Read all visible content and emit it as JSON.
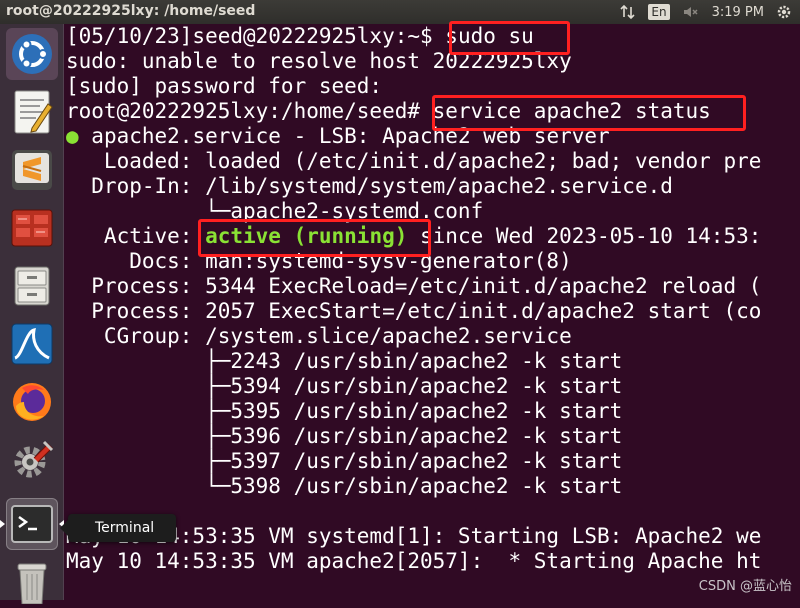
{
  "topbar": {
    "window_title": "root@20222925lxy: /home/seed",
    "lang": "En",
    "time": "3:19 PM"
  },
  "launcher": {
    "items": [
      {
        "name": "ubuntu-dash",
        "icon": "ubuntu-logo-icon"
      },
      {
        "name": "text-editor",
        "icon": "text-editor-icon"
      },
      {
        "name": "sublime-text",
        "icon": "sublime-icon"
      },
      {
        "name": "app-red",
        "icon": "app-red-icon"
      },
      {
        "name": "file-manager",
        "icon": "file-cabinet-icon"
      },
      {
        "name": "wireshark",
        "icon": "wireshark-icon"
      },
      {
        "name": "firefox",
        "icon": "firefox-icon"
      },
      {
        "name": "system-settings",
        "icon": "settings-icon"
      },
      {
        "name": "terminal",
        "icon": "terminal-icon"
      },
      {
        "name": "trash",
        "icon": "trash-icon"
      }
    ],
    "tooltip": "Terminal"
  },
  "terminal": {
    "lines": {
      "l1_prompt": "[05/10/23]seed@20222925lxy:~$ ",
      "l1_cmd": "sudo su",
      "l2": "sudo: unable to resolve host 20222925lxy",
      "l3": "[sudo] password for seed:",
      "l4_prompt": "root@20222925lxy:/home/seed# ",
      "l4_cmd": "service apache2 status",
      "l5_dot": "●",
      "l5_text": " apache2.service - LSB: Apache2 web server",
      "l6": "   Loaded: loaded (/etc/init.d/apache2; bad; vendor pre",
      "l7": "  Drop-In: /lib/systemd/system/apache2.service.d",
      "l8": "           └─apache2-systemd.conf",
      "l9_label": "   Active: ",
      "l9_status": "active (running)",
      "l9_rest": " since Wed 2023-05-10 14:53:",
      "l10": "     Docs: man:systemd-sysv-generator(8)",
      "l11": "  Process: 5344 ExecReload=/etc/init.d/apache2 reload (",
      "l12": "  Process: 2057 ExecStart=/etc/init.d/apache2 start (co",
      "l13": "   CGroup: /system.slice/apache2.service",
      "l14": "           ├─2243 /usr/sbin/apache2 -k start",
      "l15": "           ├─5394 /usr/sbin/apache2 -k start",
      "l16": "           ├─5395 /usr/sbin/apache2 -k start",
      "l17": "           ├─5396 /usr/sbin/apache2 -k start",
      "l18": "           ├─5397 /usr/sbin/apache2 -k start",
      "l19": "           └─5398 /usr/sbin/apache2 -k start",
      "l20": "",
      "l21": "May 10 14:53:35 VM systemd[1]: Starting LSB: Apache2 we",
      "l22": "May 10 14:53:35 VM apache2[2057]:  * Starting Apache ht"
    }
  },
  "watermark": "CSDN @蓝心怡",
  "colors": {
    "terminal_bg": "#300a24",
    "status_green": "#8ae234",
    "highlight_red": "#ff2020"
  }
}
